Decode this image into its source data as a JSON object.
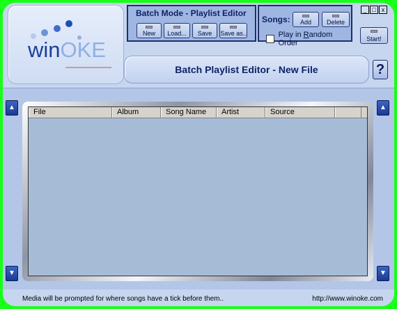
{
  "logo": {
    "win": "win",
    "oke": "OKE"
  },
  "batch_panel": {
    "title": "Batch Mode - Playlist Editor",
    "buttons": {
      "new": "New",
      "load": "Load...",
      "save": "Save",
      "save_as": "Save as.."
    }
  },
  "songs_panel": {
    "title": "Songs:",
    "buttons": {
      "add": "Add",
      "delete": "Delete"
    },
    "random_label_pre": "Play in ",
    "random_label_accel": "R",
    "random_label_post": "andom Order",
    "random_checked": false
  },
  "window_controls": {
    "minimize": "_",
    "restore": "□",
    "close": "x"
  },
  "start_button": "Start!",
  "title_bar": "Batch Playlist Editor - New File",
  "help_button": "?",
  "arrows": {
    "up": "▲",
    "down": "▼"
  },
  "table": {
    "columns": [
      "File",
      "Album",
      "Song Name",
      "Artist",
      "Source",
      ""
    ],
    "rows": []
  },
  "status": {
    "message": "Media will be prompted for where songs have a tick before them..",
    "url": "http://www.winoke.com"
  }
}
